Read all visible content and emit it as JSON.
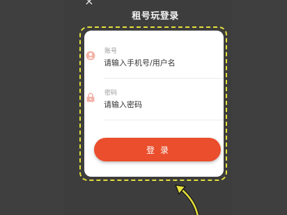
{
  "header": {
    "close_glyph": "×",
    "title": "租号玩登录"
  },
  "form": {
    "account": {
      "label": "账号",
      "placeholder": "请输入手机号/用户名",
      "icon": "user-icon"
    },
    "password": {
      "label": "密码",
      "placeholder": "请输入密码",
      "icon": "lock-icon"
    },
    "submit_label": "登录"
  },
  "colors": {
    "accent": "#ea4e2c",
    "highlight": "#e6e03a",
    "icon": "#f3b3a8"
  }
}
